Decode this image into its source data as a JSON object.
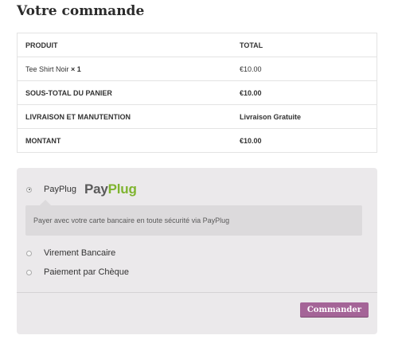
{
  "title": "Votre commande",
  "table": {
    "headers": [
      "PRODUIT",
      "TOTAL"
    ],
    "product": {
      "name": "Tee Shirt Noir",
      "qty": "× 1",
      "total": "€10.00"
    },
    "subtotal": {
      "label": "SOUS-TOTAL DU PANIER",
      "value": "€10.00"
    },
    "shipping": {
      "label": "LIVRAISON ET MANUTENTION",
      "value": "Livraison Gratuite"
    },
    "total": {
      "label": "MONTANT",
      "value": "€10.00"
    }
  },
  "payment": {
    "selected": "payplug",
    "methods": [
      {
        "id": "payplug",
        "label": "PayPlug",
        "logo_pay": "Pay",
        "logo_plug": "Plug",
        "description": "Payer avec votre carte bancaire en toute sécurité via PayPlug"
      },
      {
        "id": "bacs",
        "label": "Virement Bancaire"
      },
      {
        "id": "cheque",
        "label": "Paiement par Chèque"
      }
    ]
  },
  "place_order_label": "Commander",
  "colors": {
    "accent": "#a46497",
    "payplug_green": "#7fb42f",
    "panel_bg": "#ebe9eb"
  }
}
